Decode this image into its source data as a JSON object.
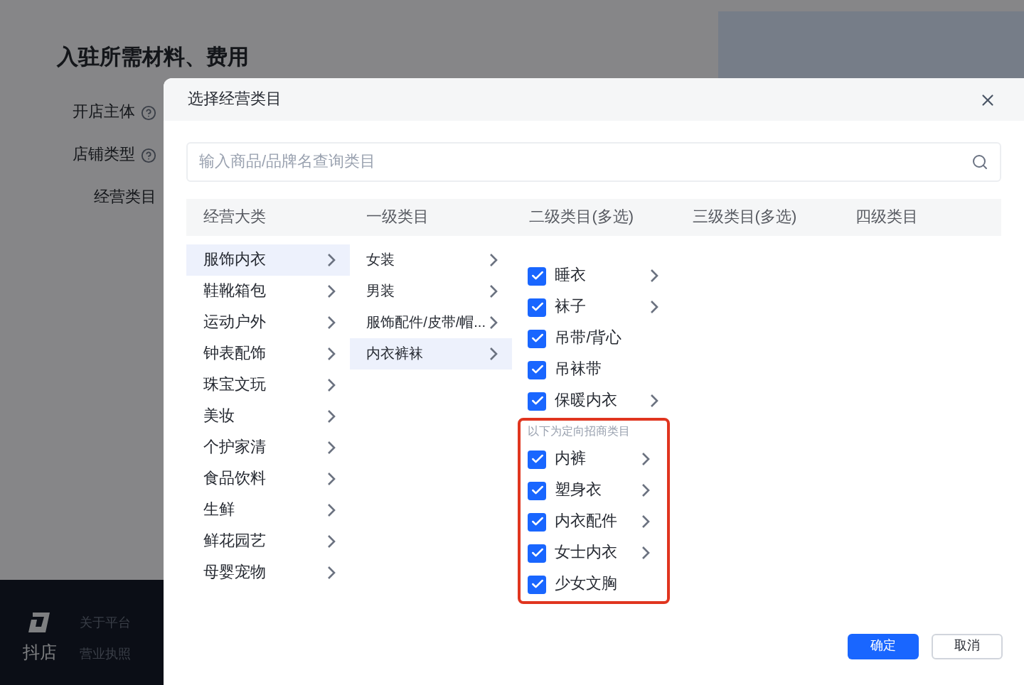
{
  "page": {
    "section_title": "入驻所需材料、费用",
    "fields": [
      {
        "label": "开店主体",
        "info": true
      },
      {
        "label": "店铺类型",
        "info": true
      },
      {
        "label": "经营类目",
        "info": false
      }
    ],
    "footer": {
      "logo_text": "抖店",
      "links": [
        "关于平台",
        "营业执照"
      ]
    }
  },
  "dialog": {
    "title": "选择经营类目",
    "search": {
      "placeholder": "输入商品/品牌名查询类目"
    },
    "columns": [
      "经营大类",
      "一级类目",
      "二级类目(多选)",
      "三级类目(多选)",
      "四级类目"
    ],
    "categories": [
      {
        "label": "服饰内衣",
        "selected": true
      },
      {
        "label": "鞋靴箱包",
        "selected": false
      },
      {
        "label": "运动户外",
        "selected": false
      },
      {
        "label": "钟表配饰",
        "selected": false
      },
      {
        "label": "珠宝文玩",
        "selected": false
      },
      {
        "label": "美妆",
        "selected": false
      },
      {
        "label": "个护家清",
        "selected": false
      },
      {
        "label": "食品饮料",
        "selected": false
      },
      {
        "label": "生鲜",
        "selected": false
      },
      {
        "label": "鲜花园艺",
        "selected": false
      },
      {
        "label": "母婴宠物",
        "selected": false
      }
    ],
    "level1": [
      {
        "label": "女装",
        "selected": false
      },
      {
        "label": "男装",
        "selected": false
      },
      {
        "label": "服饰配件/皮带/帽...",
        "selected": false
      },
      {
        "label": "内衣裤袜",
        "selected": true
      }
    ],
    "level2": [
      {
        "label": "睡衣",
        "checked": true,
        "has_children": true
      },
      {
        "label": "袜子",
        "checked": true,
        "has_children": true
      },
      {
        "label": "吊带/背心",
        "checked": true,
        "has_children": false
      },
      {
        "label": "吊袜带",
        "checked": true,
        "has_children": false
      },
      {
        "label": "保暖内衣",
        "checked": true,
        "has_children": true
      }
    ],
    "targeted": {
      "label": "以下为定向招商类目",
      "highlighted": true,
      "items": [
        {
          "label": "内裤",
          "checked": true,
          "has_children": true
        },
        {
          "label": "塑身衣",
          "checked": true,
          "has_children": true
        },
        {
          "label": "内衣配件",
          "checked": true,
          "has_children": true
        },
        {
          "label": "女士内衣",
          "checked": true,
          "has_children": true
        },
        {
          "label": "少女文胸",
          "checked": true,
          "has_children": false
        }
      ]
    },
    "buttons": [
      {
        "label": "确定",
        "kind": "primary"
      },
      {
        "label": "取消",
        "kind": "default"
      }
    ]
  }
}
